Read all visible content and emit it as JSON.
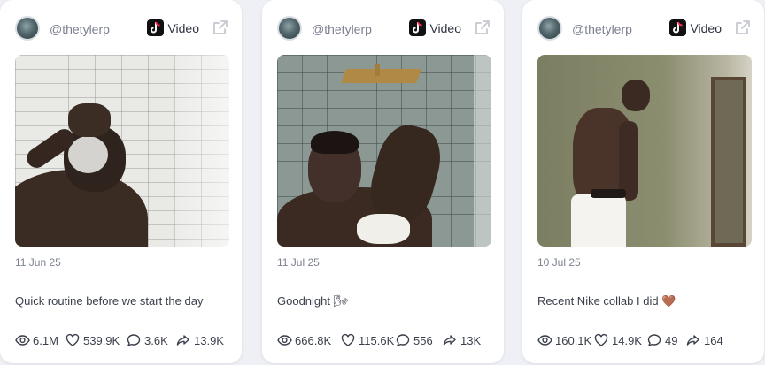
{
  "posts": [
    {
      "author": "@thetylerp",
      "source": "Video",
      "date": "11 Jun 25",
      "caption": "Quick routine before we start the day",
      "views": "6.1M",
      "likes": "539.9K",
      "comments": "3.6K",
      "shares": "13.9K"
    },
    {
      "author": "@thetylerp",
      "source": "Video",
      "date": "11 Jul 25",
      "caption": "Goodnight 🌬",
      "views": "666.8K",
      "likes": "115.6K",
      "comments": "556",
      "shares": "13K"
    },
    {
      "author": "@thetylerp",
      "source": "Video",
      "date": "10 Jul 25",
      "caption": "Recent Nike collab I did 🤎",
      "views": "160.1K",
      "likes": "14.9K",
      "comments": "49",
      "shares": "164"
    }
  ],
  "colors": {
    "page_background": "#eef0f5",
    "card_background": "#ffffff",
    "muted_text": "#7c8290",
    "icon_stroke": "#3a3f4b"
  },
  "icons": [
    "avatar",
    "tiktok-icon",
    "external-link-icon",
    "eye-icon",
    "heart-icon",
    "comment-icon",
    "share-icon"
  ]
}
